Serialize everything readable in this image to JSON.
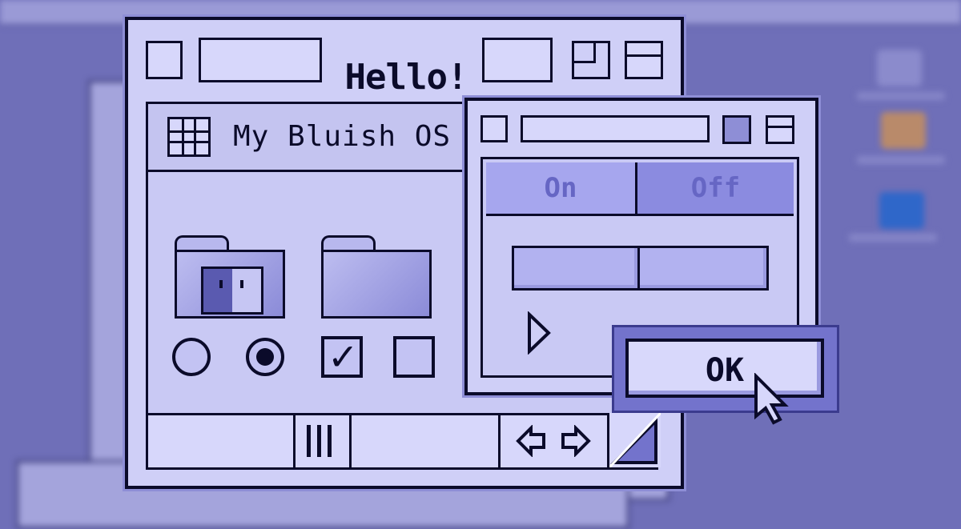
{
  "window": {
    "title": "Hello!"
  },
  "inner_window": {
    "title": "My Bluish OS"
  },
  "toggle": {
    "on_label": "On",
    "off_label": "Off",
    "selected": "On"
  },
  "dialog": {
    "ok_label": "OK"
  },
  "controls": {
    "radio_1_checked": false,
    "radio_2_checked": true,
    "checkbox_1_checked": true,
    "checkbox_2_checked": false
  },
  "colors": {
    "desktop": "#6f6fb8",
    "window_fill": "#cfcff7",
    "outline": "#0b0b2a",
    "accent": "#7373cc"
  },
  "icons": [
    "grid-icon",
    "finder-folder-icon",
    "folder-icon",
    "play-arrow-icon",
    "left-arrow-icon",
    "right-arrow-icon",
    "resize-grip-icon",
    "zoom-box-icon",
    "collapse-box-icon",
    "pointer-cursor-icon"
  ]
}
